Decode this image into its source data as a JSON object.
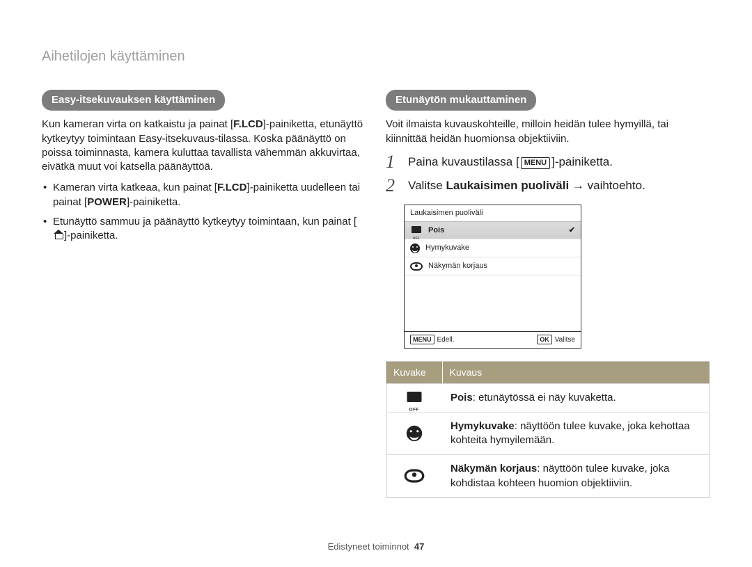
{
  "page_title": "Aihetilojen käyttäminen",
  "left": {
    "heading": "Easy-itsekuvauksen käyttäminen",
    "intro_parts": [
      "Kun kameran virta on katkaistu ja painat [",
      "F.LCD",
      "]-painiketta, etunäyttö kytkeytyy toimintaan Easy-itsekuvaus-tilassa. Koska päänäyttö on poissa toiminnasta, kamera kuluttaa tavallista vähemmän akkuvirtaa, eivätkä muut voi katsella päänäyttöä."
    ],
    "bullet1_parts": [
      "Kameran virta katkeaa, kun painat [",
      "F.LCD",
      "]-painiketta uudelleen tai painat [",
      "POWER",
      "]-painiketta."
    ],
    "bullet2_parts": [
      "Etunäyttö sammuu ja päänäyttö kytkeytyy toimintaan, kun painat [",
      "]-painiketta."
    ]
  },
  "right": {
    "heading": "Etunäytön mukauttaminen",
    "intro": "Voit ilmaista kuvauskohteille, milloin heidän tulee hymyillä, tai kiinnittää heidän huomionsa objektiiviin.",
    "step1_parts": [
      "Paina kuvaustilassa [",
      "MENU",
      "]-painiketta."
    ],
    "step2_parts": [
      "Valitse ",
      "Laukaisimen puoliväli",
      " → vaihtoehto."
    ]
  },
  "lcd": {
    "header": "Laukaisimen puoliväli",
    "items": [
      {
        "icon": "off",
        "label": "Pois",
        "selected": true
      },
      {
        "icon": "smile",
        "label": "Hymykuvake",
        "selected": false
      },
      {
        "icon": "eye",
        "label": "Näkymän korjaus",
        "selected": false
      }
    ],
    "footer_left_chip": "MENU",
    "footer_left_text": "Edell.",
    "footer_right_chip": "OK",
    "footer_right_text": "Valitse"
  },
  "table": {
    "col1": "Kuvake",
    "col2": "Kuvaus",
    "rows": [
      {
        "icon": "off",
        "bold": "Pois",
        "text": ": etunäytössä ei näy kuvaketta."
      },
      {
        "icon": "smile",
        "bold": "Hymykuvake",
        "text": ": näyttöön tulee kuvake, joka kehottaa kohteita hymyilemään."
      },
      {
        "icon": "eye",
        "bold": "Näkymän korjaus",
        "text": ": näyttöön tulee kuvake, joka kohdistaa kohteen huomion objektiiviin."
      }
    ]
  },
  "footer": {
    "section": "Edistyneet toiminnot",
    "page": "47"
  }
}
